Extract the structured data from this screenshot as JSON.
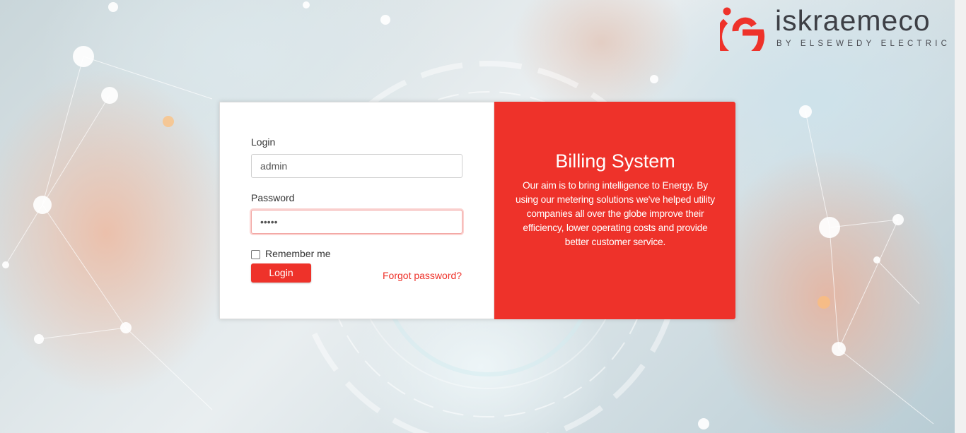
{
  "brand": {
    "name": "iskraemeco",
    "tagline": "BY ELSEWEDY ELECTRIC",
    "logo_icon": "iskraemeco-logo-icon",
    "accent_color": "#ee322a"
  },
  "login_form": {
    "login_label": "Login",
    "login_value": "admin",
    "password_label": "Password",
    "password_value": "•••••",
    "remember_label": "Remember me",
    "remember_checked": false,
    "submit_label": "Login",
    "forgot_label": "Forgot password?"
  },
  "info": {
    "title": "Billing System",
    "description": "Our aim is to bring intelligence to Energy. By using our metering solutions we've helped utility companies all over the globe improve their efficiency, lower operating costs and provide better customer service."
  }
}
